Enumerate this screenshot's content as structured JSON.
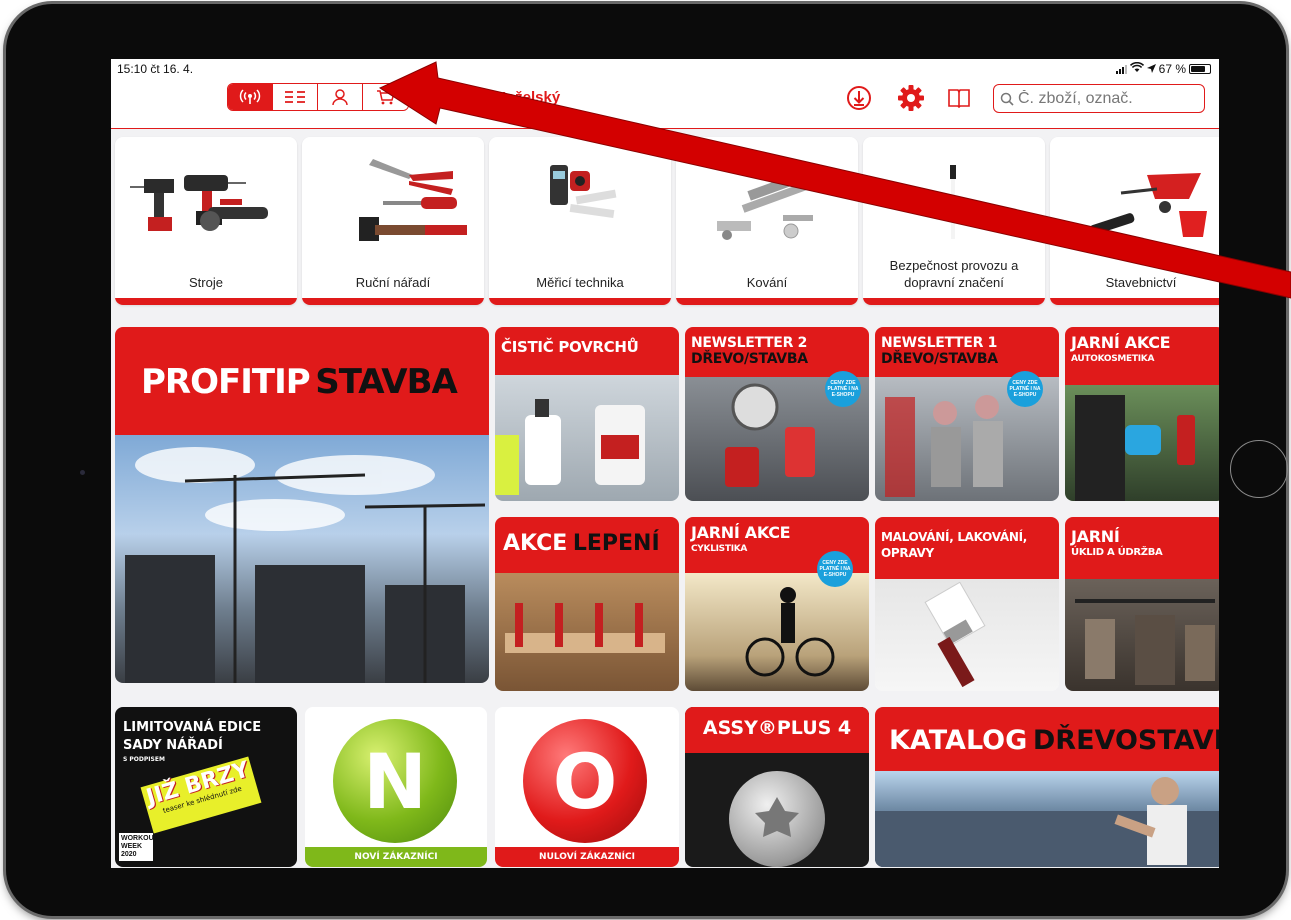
{
  "status_bar": {
    "time_date": "15:10  čt 16. 4.",
    "battery": "67 %"
  },
  "nav": {
    "user_name": "Ivan Koželský",
    "search_placeholder": "Č. zboží, označ.",
    "segments": [
      "online-mode-icon",
      "list-view-icon",
      "user-icon",
      "cart-icon"
    ]
  },
  "categories": [
    {
      "label": "Stroje"
    },
    {
      "label": "Ruční nářadí"
    },
    {
      "label": "Měřicí technika"
    },
    {
      "label": "Kování"
    },
    {
      "label": "Bezpečnost provozu a dopravní značení"
    },
    {
      "label": "Stavebnictví"
    }
  ],
  "tiles": {
    "profitip": {
      "word1": "PROFITIP",
      "word2": "STAVBA"
    },
    "cistic": {
      "title": "ČISTIČ POVRCHŮ"
    },
    "newsletter2": {
      "line1": "NEWSLETTER 2",
      "line2": "DŘEVO/STAVBA",
      "badge": "CENY ZDE PLATNÉ I NA E-SHOPU"
    },
    "newsletter1": {
      "line1": "NEWSLETTER 1",
      "line2": "DŘEVO/STAVBA",
      "badge": "CENY ZDE PLATNÉ I NA E-SHOPU"
    },
    "jarni_auto": {
      "line1": "JARNÍ AKCE",
      "line2": "AUTOKOSMETIKA"
    },
    "lepeni": {
      "word1": "AKCE",
      "word2": "LEPENÍ"
    },
    "jarni_cyklo": {
      "line1": "JARNÍ AKCE",
      "line2": "CYKLISTIKA",
      "badge": "CENY ZDE PLATNÉ I NA E-SHOPU"
    },
    "malovani": {
      "line1": "MALOVÁNÍ, LAKOVÁNÍ,",
      "line2": "OPRAVY"
    },
    "jarni_uklid": {
      "line1": "JARNÍ",
      "line2": "ÚKLID A ÚDRŽBA"
    },
    "limited": {
      "line1": "LIMITOVANÁ EDICE",
      "line2": "SADY NÁŘADÍ",
      "sub": "S PODPISEM",
      "sticker": "JIŽ BRZY",
      "sticker_sub": "teaser ke shlédnutí zde",
      "footer": "WORKOUT WEEK 2020"
    },
    "novi": {
      "letter": "N",
      "caption": "NOVÍ ZÁKAZNÍCI"
    },
    "nulovi": {
      "letter": "O",
      "caption": "NULOVÍ ZÁKAZNÍCI"
    },
    "assy": {
      "title": "ASSY®PLUS 4"
    },
    "katalog": {
      "word1": "KATALOG",
      "word2": "DŘEVOSTAVBY"
    }
  },
  "colors": {
    "accent": "#e01a1a",
    "badge": "#1aa0dc"
  }
}
